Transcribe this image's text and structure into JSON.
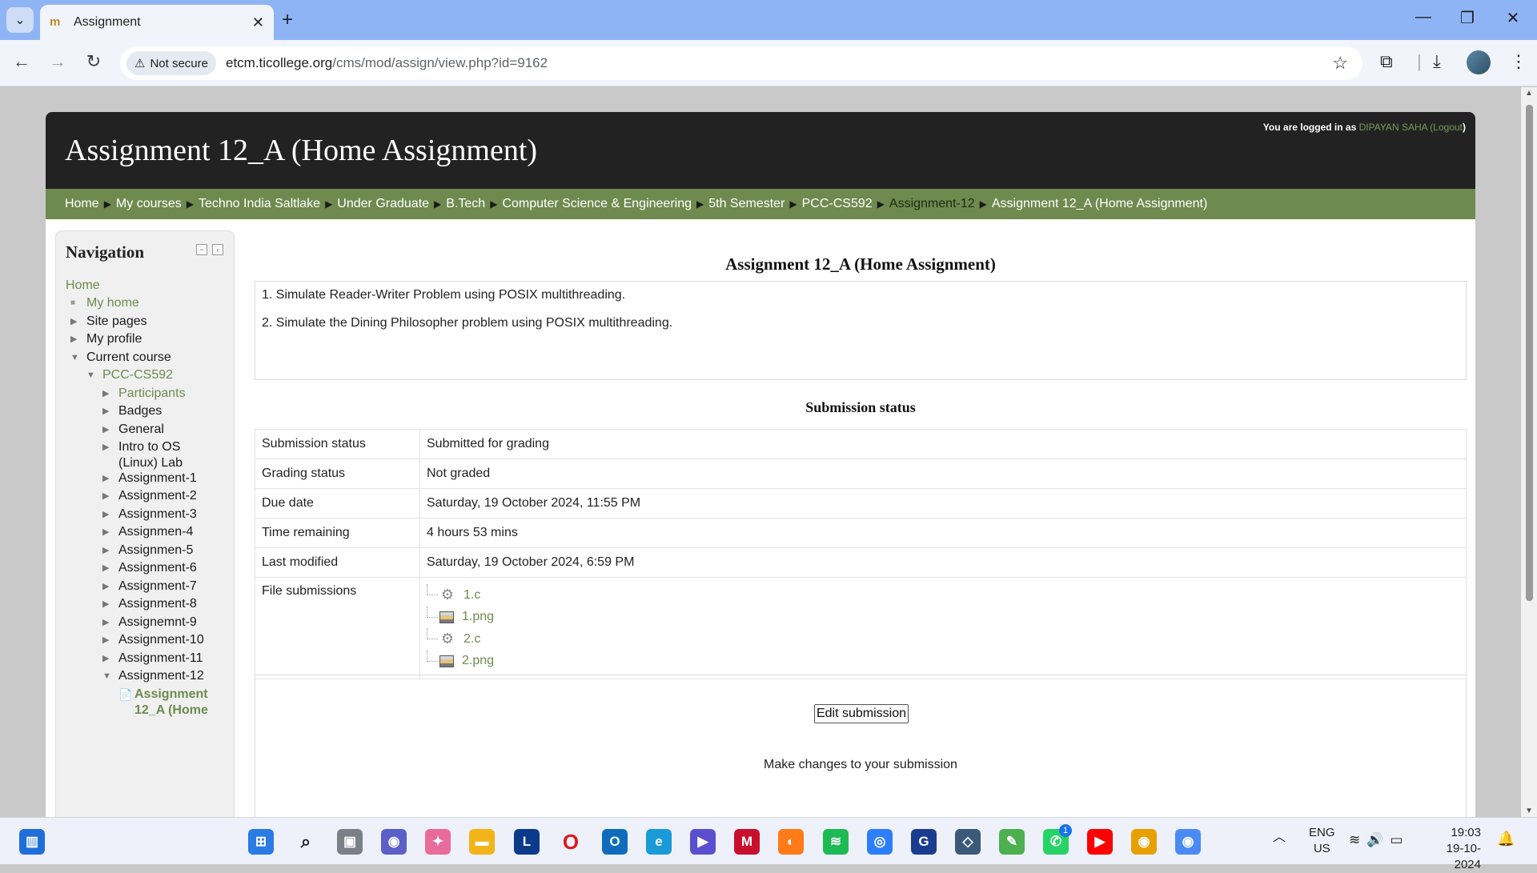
{
  "browser": {
    "tab_title": "Assignment",
    "favicon_glyph": "m",
    "new_tab_label": "+",
    "tab_close": "✕",
    "security_label": "Not secure",
    "url_host": "etcm.ticollege.org",
    "url_path": "/cms/mod/assign/view.php?id=9162"
  },
  "header": {
    "title": "Assignment 12_A (Home Assignment)",
    "logged_in_prefix": "You are logged in as ",
    "user_name": "DIPAYAN SAHA",
    "logout_open": " (",
    "logout_label": "Logout",
    "logout_close": ")"
  },
  "breadcrumb": [
    "Home",
    "My courses",
    "Techno India Saltlake",
    "Under Graduate",
    "B.Tech",
    "Computer Science & Engineering",
    "5th Semester",
    "PCC-CS592",
    "Assignment-12",
    "Assignment 12_A (Home Assignment)"
  ],
  "navigation": {
    "heading": "Navigation",
    "items": [
      "Home",
      "My home",
      "Site pages",
      "My profile",
      "Current course",
      "PCC-CS592",
      "Participants",
      "Badges",
      "General",
      "Intro to OS",
      "(Linux) Lab",
      "Assignment-1",
      "Assignment-2",
      "Assignment-3",
      "Assignmen-4",
      "Assignmen-5",
      "Assignment-6",
      "Assignment-7",
      "Assignment-8",
      "Assignemnt-9",
      "Assignment-10",
      "Assignment-11",
      "Assignment-12",
      "Assignment",
      "12_A (Home"
    ]
  },
  "main": {
    "heading": "Assignment 12_A (Home Assignment)",
    "intro": [
      "1. Simulate Reader-Writer Problem using POSIX multithreading.",
      "2. Simulate the Dining Philosopher problem using POSIX multithreading."
    ],
    "status_heading": "Submission status",
    "rows": [
      {
        "label": "Submission status",
        "value": "Submitted for grading"
      },
      {
        "label": "Grading status",
        "value": "Not graded"
      },
      {
        "label": "Due date",
        "value": "Saturday, 19 October 2024, 11:55 PM"
      },
      {
        "label": "Time remaining",
        "value": "4 hours 53 mins"
      },
      {
        "label": "Last modified",
        "value": "Saturday, 19 October 2024, 6:59 PM"
      }
    ],
    "files_label": "File submissions",
    "files": [
      "1.c",
      "1.png",
      "2.c",
      "2.png"
    ],
    "edit_button": "Edit submission",
    "edit_desc": "Make changes to your submission"
  },
  "taskbar": {
    "lang_1": "ENG",
    "lang_2": "US",
    "time": "19:03",
    "date": "19-10-2024",
    "notification_badge": "1",
    "colors": {
      "accent_green": "#6f8a4f",
      "header_dark": "#222222",
      "chrome_blue": "#8eb4f5"
    }
  }
}
